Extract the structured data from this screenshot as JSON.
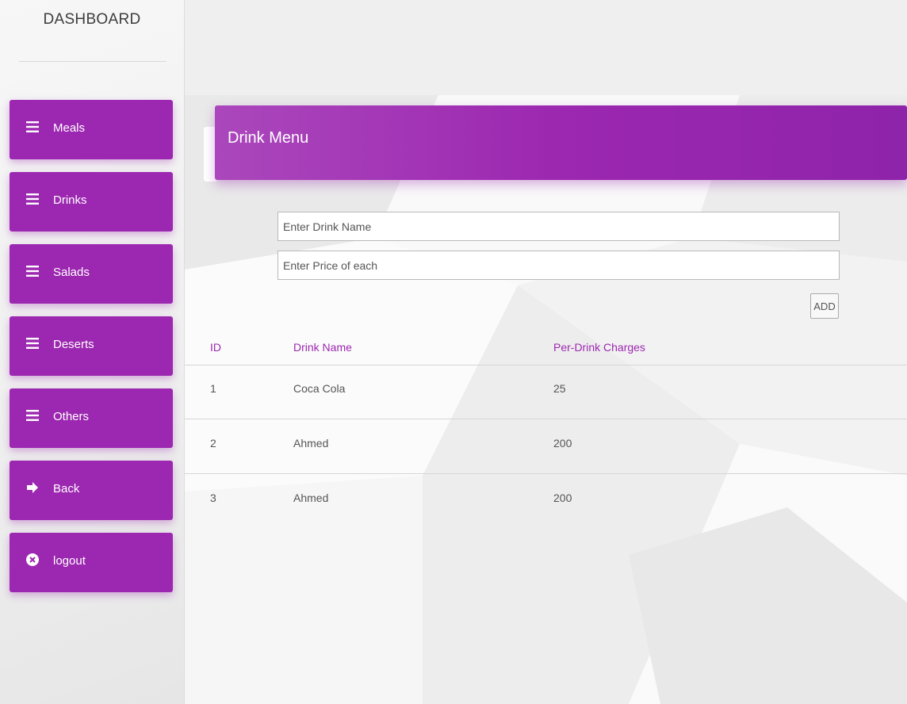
{
  "sidebar": {
    "title": "DASHBOARD",
    "items": [
      {
        "label": "Meals",
        "icon": "menu-icon"
      },
      {
        "label": "Drinks",
        "icon": "menu-icon"
      },
      {
        "label": "Salads",
        "icon": "menu-icon"
      },
      {
        "label": "Deserts",
        "icon": "menu-icon"
      },
      {
        "label": "Others",
        "icon": "menu-icon"
      },
      {
        "label": "Back",
        "icon": "arrow-right-icon"
      },
      {
        "label": "logout",
        "icon": "close-circle-icon"
      }
    ]
  },
  "main": {
    "card_title": "Drink Menu",
    "form": {
      "name_placeholder": "Enter Drink Name",
      "price_placeholder": "Enter Price of each",
      "add_label": "ADD"
    },
    "table": {
      "columns": [
        "ID",
        "Drink Name",
        "Per-Drink Charges"
      ],
      "rows": [
        [
          "1",
          "Coca Cola",
          "25"
        ],
        [
          "2",
          "Ahmed",
          "200"
        ],
        [
          "3",
          "Ahmed",
          "200"
        ]
      ]
    }
  },
  "colors": {
    "accent": "#9c27b0",
    "background": "#eeeeee",
    "text": "#555555"
  }
}
